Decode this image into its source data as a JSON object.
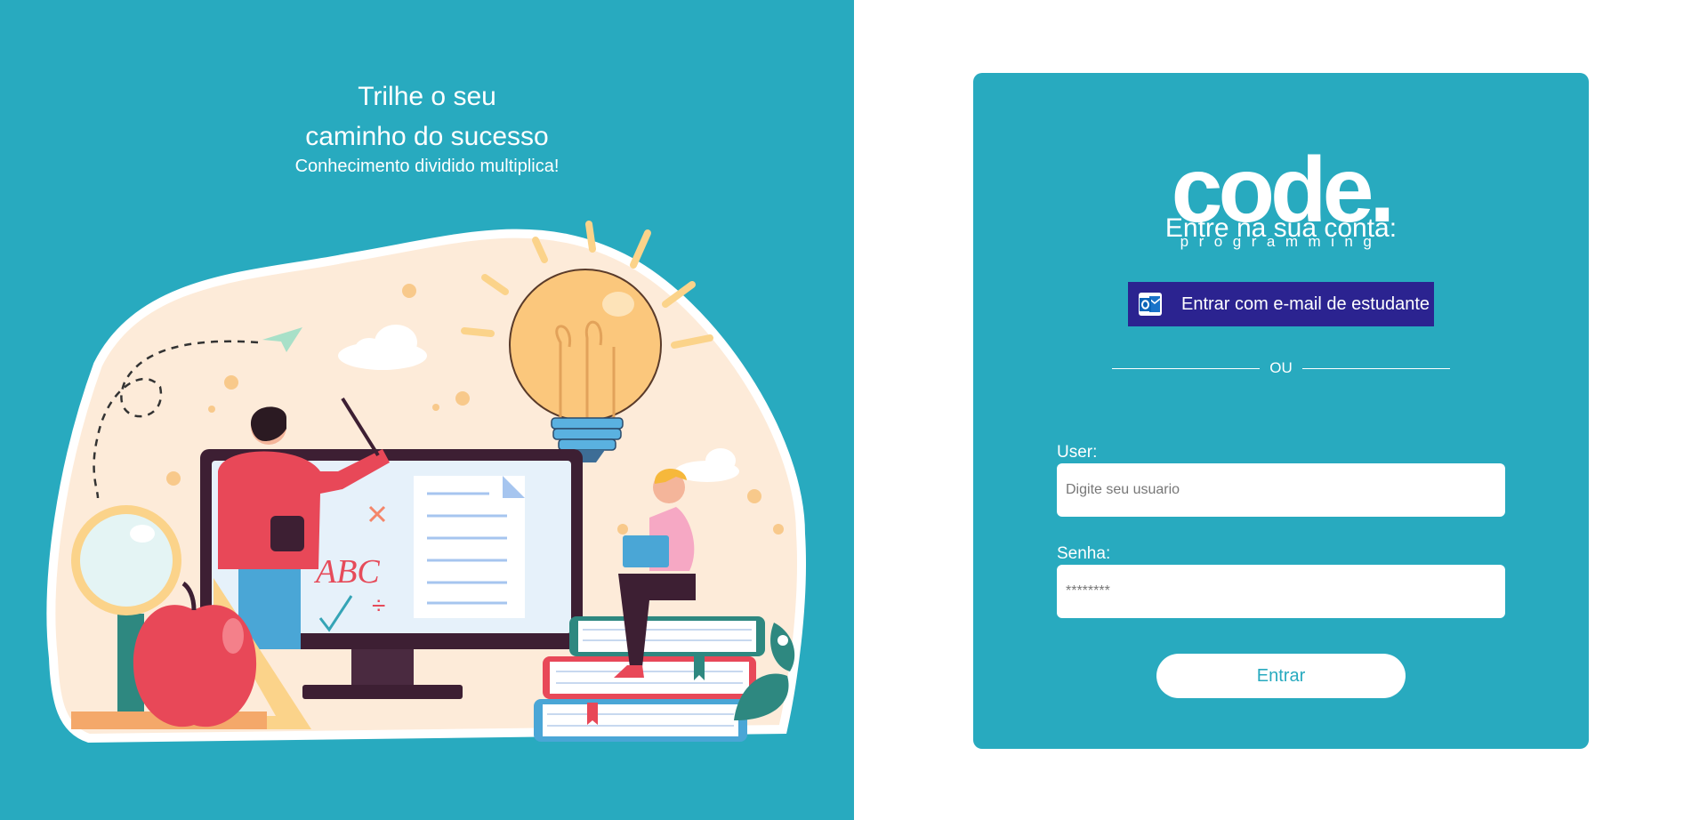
{
  "hero": {
    "title_line1": "Trilhe o seu",
    "title_line2": "caminho do sucesso",
    "subtitle": "Conhecimento dividido multiplica!",
    "illustration": {
      "board_letters": "ABC",
      "math_symbol": "÷"
    }
  },
  "brand": {
    "logo_word": "code.",
    "logo_sub": "programming"
  },
  "login": {
    "title": "Entre na sua conta:",
    "microsoft_button": "Entrar com e-mail de estudante",
    "microsoft_icon": "outlook-icon",
    "divider_text": "OU",
    "user_label": "User:",
    "user_placeholder": "Digite seu usuario",
    "password_label": "Senha:",
    "password_placeholder": "********",
    "submit": "Entrar"
  },
  "colors": {
    "teal": "#28aabf",
    "button_navy": "#2b2390",
    "white": "#ffffff"
  }
}
